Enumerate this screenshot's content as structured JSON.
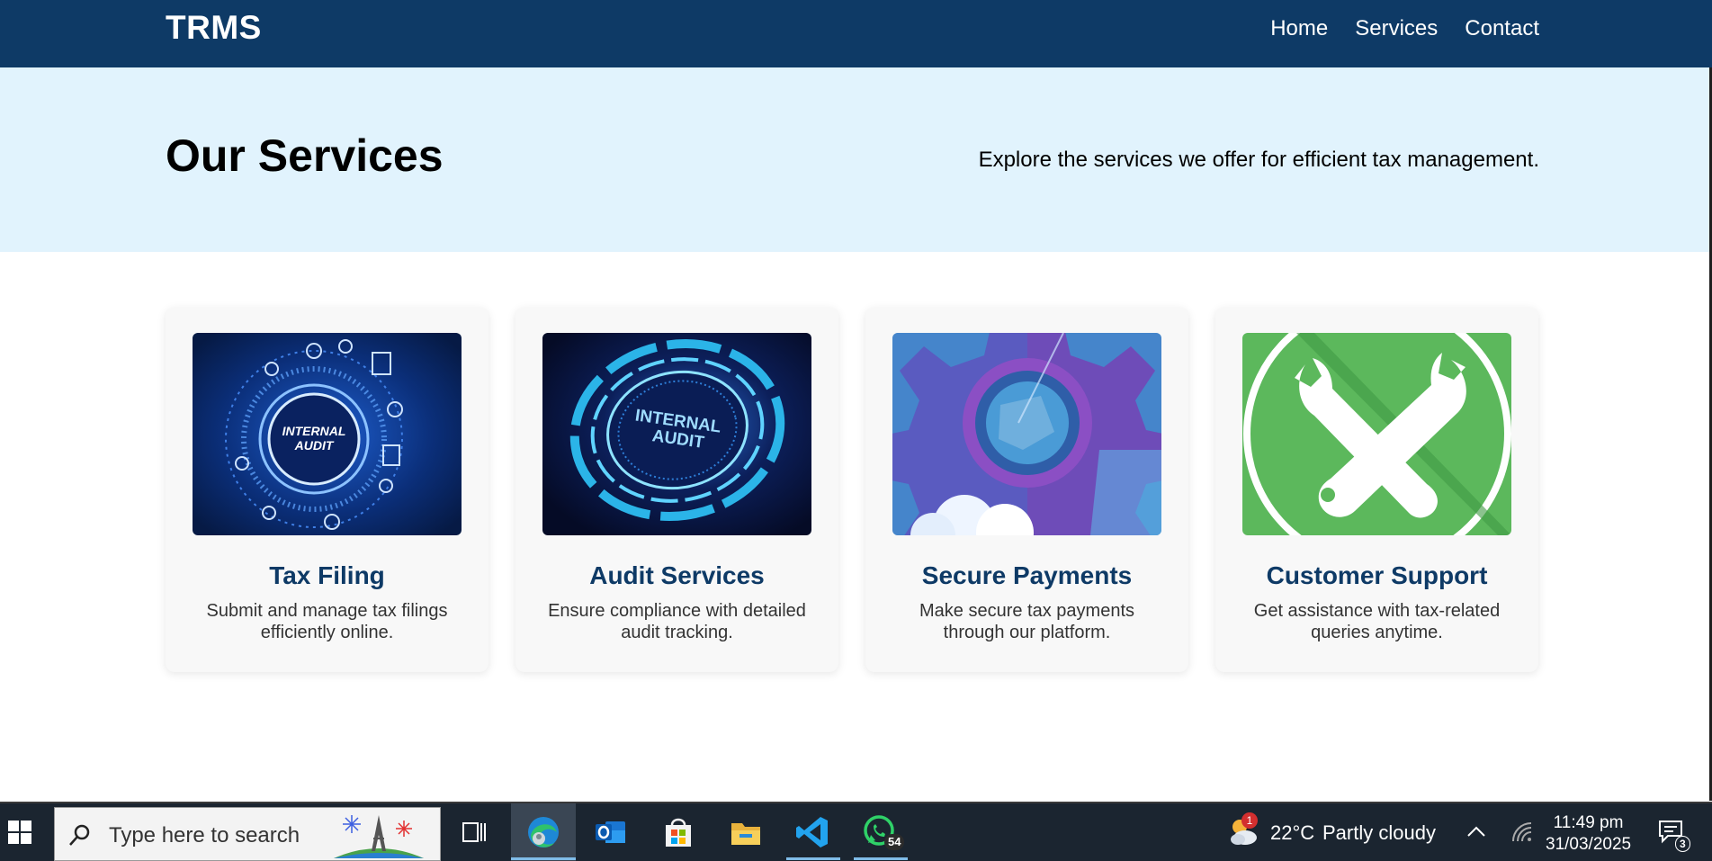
{
  "header": {
    "brand": "TRMS",
    "nav": [
      {
        "label": "Home"
      },
      {
        "label": "Services"
      },
      {
        "label": "Contact"
      }
    ]
  },
  "hero": {
    "title": "Our Services",
    "subtitle": "Explore the services we offer for efficient tax management."
  },
  "cards": [
    {
      "title": "Tax Filing",
      "desc": "Submit and manage tax filings efficiently online.",
      "image_text": [
        "INTERNAL",
        "AUDIT"
      ]
    },
    {
      "title": "Audit Services",
      "desc": "Ensure compliance with detailed audit tracking.",
      "image_text": [
        "INTERNAL",
        "AUDIT"
      ]
    },
    {
      "title": "Secure Payments",
      "desc": "Make secure tax payments through our platform."
    },
    {
      "title": "Customer Support",
      "desc": "Get assistance with tax-related queries anytime."
    }
  ],
  "taskbar": {
    "search_placeholder": "Type here to search",
    "apps": [
      {
        "name": "task-view-icon"
      },
      {
        "name": "edge-icon",
        "active": true
      },
      {
        "name": "outlook-icon"
      },
      {
        "name": "store-icon"
      },
      {
        "name": "file-explorer-icon"
      },
      {
        "name": "vscode-icon",
        "underlined": true
      },
      {
        "name": "whatsapp-icon",
        "badge": "54",
        "underlined": true
      }
    ],
    "weather": {
      "badge": "1",
      "temp": "22°C",
      "condition": "Partly cloudy"
    },
    "time": "11:49 pm",
    "date": "31/03/2025",
    "notification_count": "3"
  },
  "colors": {
    "header_bg": "#0e3a66",
    "hero_bg": "#e1f3fd",
    "card_title": "#0e3a66",
    "taskbar_bg": "#1b2530"
  }
}
